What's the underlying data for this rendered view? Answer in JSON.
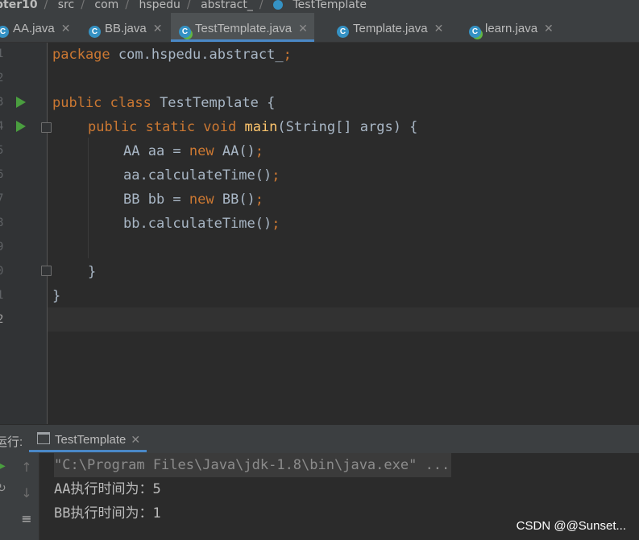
{
  "breadcrumb": [
    "pter10",
    "src",
    "com",
    "hspedu",
    "abstract_",
    "TestTemplate"
  ],
  "tabs": [
    {
      "icon": "C",
      "label": "AA.java",
      "active": false
    },
    {
      "icon": "C",
      "label": "BB.java",
      "active": false
    },
    {
      "icon": "C",
      "label": "TestTemplate.java",
      "active": true
    },
    {
      "icon": "C",
      "label": "Template.java",
      "active": false
    },
    {
      "icon": "C",
      "label": "learn.java",
      "active": false
    }
  ],
  "line_numbers": [
    "1",
    "2",
    "3",
    "4",
    "5",
    "6",
    "7",
    "8",
    "9",
    "0",
    "1",
    "2"
  ],
  "code": {
    "l1_kw": "package",
    "l1_rest": " com.hspedu.abstract_",
    "l1_semi": ";",
    "l3_kw": "public class",
    "l3_rest": " TestTemplate {",
    "l4_kw": "public static void",
    "l4_fn": " main",
    "l4_rest": "(String[] args) {",
    "l5_a": "AA aa = ",
    "l5_kw": "new",
    "l5_b": " AA()",
    "l5_semi": ";",
    "l6_a": "aa.calculateTime()",
    "l6_semi": ";",
    "l7_a": "BB bb = ",
    "l7_kw": "new",
    "l7_b": " BB()",
    "l7_semi": ";",
    "l8_a": "bb.calculateTime()",
    "l8_semi": ";",
    "l10": "}",
    "l11": "}"
  },
  "run_panel": {
    "label": "运行:",
    "tab_label": "TestTemplate",
    "output": [
      "\"C:\\Program Files\\Java\\jdk-1.8\\bin\\java.exe\" ...",
      "AA执行时间为：5",
      "BB执行时间为：1"
    ]
  },
  "watermark": "CSDN @@Sunset...",
  "icons": {
    "run_gutter": "run-arrow-icon",
    "tab_class": "java-class-icon",
    "close": "close-icon"
  },
  "colors": {
    "keyword": "#cc7832",
    "method": "#ffc66d",
    "text": "#a9b7c6",
    "run_green": "#4a9e3f",
    "tab_accent": "#4a88c7"
  }
}
